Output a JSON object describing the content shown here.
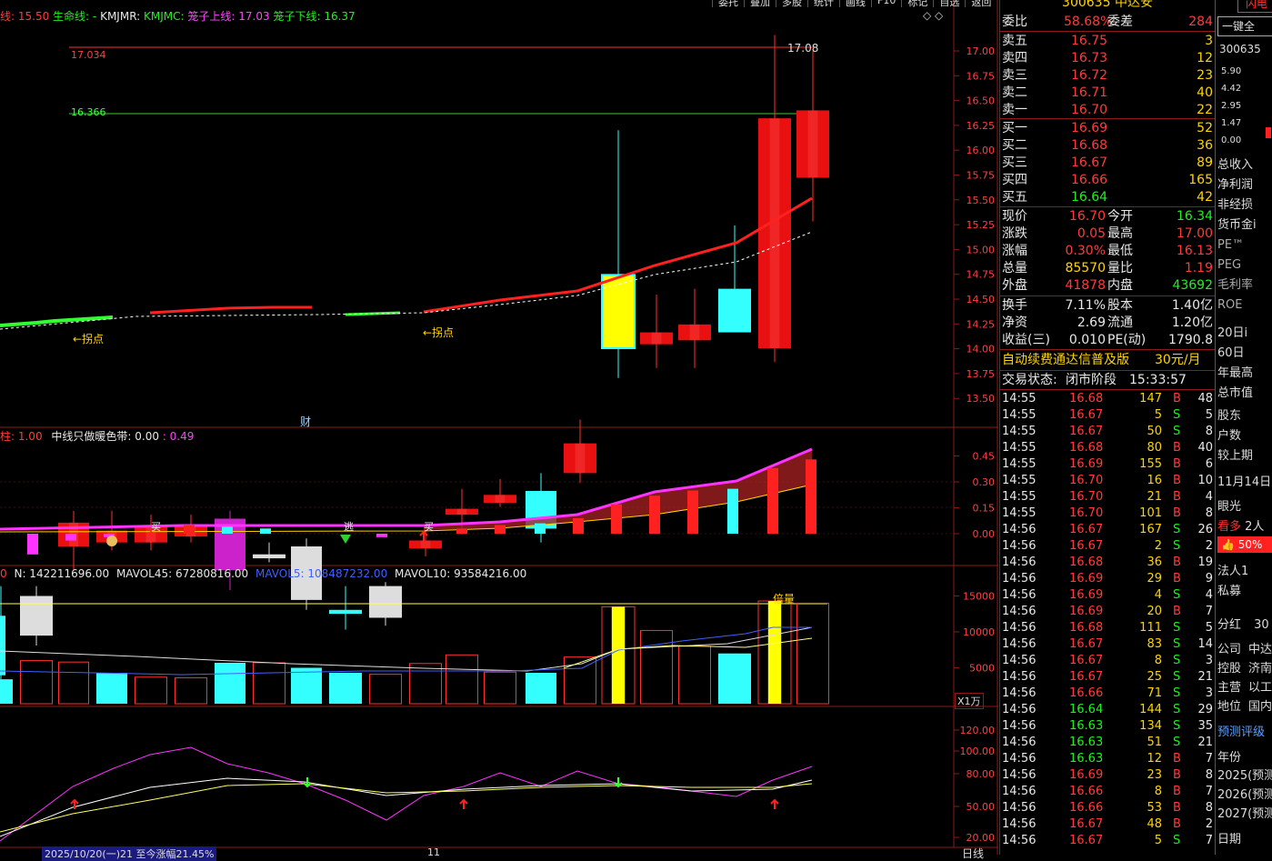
{
  "top_line": {
    "prefix": "线: 15.50",
    "shengming": "生命线: -",
    "kmjmr": "KMJMR:",
    "kmjmc": "KMJMC:",
    "up_label": "笼子上线: 17.03",
    "down_label": "笼子下线: 16.37"
  },
  "menu": [
    "委托",
    "叠加",
    "多股",
    "统计",
    "画线",
    "F10",
    "标记",
    "自选",
    "返回"
  ],
  "price_axis": [
    "17.00",
    "16.75",
    "16.50",
    "16.25",
    "16.00",
    "15.75",
    "15.50",
    "15.25",
    "15.00",
    "14.75",
    "14.50",
    "14.25",
    "14.00",
    "13.75",
    "13.50"
  ],
  "main_annotations": {
    "high_mark": "17.08",
    "upper_line": "17.034",
    "lower_line": "16.366",
    "guaidian_1": "←拐点",
    "guaidian_2": "←拐点",
    "cai": "财"
  },
  "ind1": {
    "title_a": "柱: 1.00",
    "title_b": "中线只做暖色带: 0.00",
    "title_c": ": 0.49",
    "axis": [
      "0.45",
      "0.30",
      "0.15",
      "0.00"
    ],
    "mark_buy1": "买",
    "mark_escape": "逃",
    "mark_buy2": "买"
  },
  "vol": {
    "t1": "0",
    "t2": "N: 142211696.00",
    "t3": "MAVOL45: 67280816.00",
    "t4": "MAVOL5: 108487232.00",
    "t5": "MAVOL10: 93584216.00",
    "axis": [
      "15000",
      "10000",
      "5000"
    ],
    "unit": "X1万",
    "beiliang": "倍量"
  },
  "ind3": {
    "axis": [
      "120.00",
      "100.00",
      "80.00",
      "50.00",
      "20.00"
    ]
  },
  "bottom": {
    "status": "2025/10/20(一)21 至今涨幅21.45%",
    "month": "11",
    "period": "日线"
  },
  "quote": {
    "code": "300635",
    "name": "中达安",
    "weibi_label": "委比",
    "weibi_val": "58.68%",
    "weicha_label": "委差",
    "weicha_val": "284",
    "sells": [
      {
        "label": "卖五",
        "price": "16.75",
        "vol": "3"
      },
      {
        "label": "卖四",
        "price": "16.73",
        "vol": "12"
      },
      {
        "label": "卖三",
        "price": "16.72",
        "vol": "23"
      },
      {
        "label": "卖二",
        "price": "16.71",
        "vol": "40"
      },
      {
        "label": "卖一",
        "price": "16.70",
        "vol": "22"
      }
    ],
    "buys": [
      {
        "label": "买一",
        "price": "16.69",
        "vol": "52"
      },
      {
        "label": "买二",
        "price": "16.68",
        "vol": "36"
      },
      {
        "label": "买三",
        "price": "16.67",
        "vol": "89"
      },
      {
        "label": "买四",
        "price": "16.66",
        "vol": "165"
      },
      {
        "label": "买五",
        "price": "16.64",
        "vol": "42"
      }
    ],
    "stats": [
      {
        "l1": "现价",
        "v1": "16.70",
        "l2": "今开",
        "v2": "16.34"
      },
      {
        "l1": "涨跌",
        "v1": "0.05",
        "l2": "最高",
        "v2": "17.00"
      },
      {
        "l1": "涨幅",
        "v1": "0.30%",
        "l2": "最低",
        "v2": "16.13"
      },
      {
        "l1": "总量",
        "v1": "85570",
        "l2": "量比",
        "v2": "1.19"
      },
      {
        "l1": "外盘",
        "v1": "41878",
        "l2": "内盘",
        "v2": "43692"
      }
    ],
    "stats2": [
      {
        "l1": "换手",
        "v1": "7.11%",
        "l2": "股本",
        "v2": "1.40亿"
      },
      {
        "l1": "净资",
        "v1": "2.69",
        "l2": "流通",
        "v2": "1.20亿"
      },
      {
        "l1": "收益(三)",
        "v1": "0.010",
        "l2": "PE(动)",
        "v2": "1790.8"
      }
    ],
    "promo": "自动续费通达信普及版",
    "promo_price": "30元/月",
    "trade_status_label": "交易状态:",
    "trade_status": "闭市阶段",
    "trade_time": "15:33:57"
  },
  "ticks": [
    {
      "t": "14:55",
      "p": "16.68",
      "v": "147",
      "d": "B",
      "n": "48"
    },
    {
      "t": "14:55",
      "p": "16.67",
      "v": "5",
      "d": "S",
      "n": "5"
    },
    {
      "t": "14:55",
      "p": "16.67",
      "v": "50",
      "d": "S",
      "n": "8"
    },
    {
      "t": "14:55",
      "p": "16.68",
      "v": "80",
      "d": "B",
      "n": "40"
    },
    {
      "t": "14:55",
      "p": "16.69",
      "v": "155",
      "d": "B",
      "n": "6"
    },
    {
      "t": "14:55",
      "p": "16.70",
      "v": "16",
      "d": "B",
      "n": "10"
    },
    {
      "t": "14:55",
      "p": "16.70",
      "v": "21",
      "d": "B",
      "n": "4"
    },
    {
      "t": "14:55",
      "p": "16.70",
      "v": "101",
      "d": "B",
      "n": "8"
    },
    {
      "t": "14:56",
      "p": "16.67",
      "v": "167",
      "d": "S",
      "n": "26"
    },
    {
      "t": "14:56",
      "p": "16.67",
      "v": "2",
      "d": "S",
      "n": "2"
    },
    {
      "t": "14:56",
      "p": "16.68",
      "v": "36",
      "d": "B",
      "n": "19"
    },
    {
      "t": "14:56",
      "p": "16.69",
      "v": "29",
      "d": "B",
      "n": "9"
    },
    {
      "t": "14:56",
      "p": "16.69",
      "v": "4",
      "d": "S",
      "n": "4"
    },
    {
      "t": "14:56",
      "p": "16.69",
      "v": "20",
      "d": "B",
      "n": "7"
    },
    {
      "t": "14:56",
      "p": "16.68",
      "v": "111",
      "d": "S",
      "n": "5"
    },
    {
      "t": "14:56",
      "p": "16.67",
      "v": "83",
      "d": "S",
      "n": "14"
    },
    {
      "t": "14:56",
      "p": "16.67",
      "v": "8",
      "d": "S",
      "n": "3"
    },
    {
      "t": "14:56",
      "p": "16.67",
      "v": "25",
      "d": "S",
      "n": "21"
    },
    {
      "t": "14:56",
      "p": "16.66",
      "v": "71",
      "d": "S",
      "n": "3"
    },
    {
      "t": "14:56",
      "p": "16.64",
      "v": "144",
      "d": "S",
      "n": "29"
    },
    {
      "t": "14:56",
      "p": "16.63",
      "v": "134",
      "d": "S",
      "n": "35"
    },
    {
      "t": "14:56",
      "p": "16.63",
      "v": "51",
      "d": "S",
      "n": "21"
    },
    {
      "t": "14:56",
      "p": "16.63",
      "v": "12",
      "d": "B",
      "n": "7"
    },
    {
      "t": "14:56",
      "p": "16.69",
      "v": "23",
      "d": "B",
      "n": "8"
    },
    {
      "t": "14:56",
      "p": "16.66",
      "v": "8",
      "d": "B",
      "n": "7"
    },
    {
      "t": "14:56",
      "p": "16.66",
      "v": "53",
      "d": "B",
      "n": "8"
    },
    {
      "t": "14:56",
      "p": "16.67",
      "v": "48",
      "d": "B",
      "n": "2"
    },
    {
      "t": "14:56",
      "p": "16.67",
      "v": "5",
      "d": "S",
      "n": "7"
    }
  ],
  "side": {
    "tab": "闪电",
    "btn": "一键全",
    "code": "300635",
    "axis": [
      "5.90",
      "4.42",
      "2.95",
      "1.47",
      "0.00"
    ],
    "items": [
      "总收入",
      "净利润",
      "非经损",
      "货币金i",
      "PE™",
      "PEG",
      "毛利率",
      "ROE"
    ],
    "items2": [
      "20日i",
      "60日",
      "年最高",
      "总市值"
    ],
    "items3": [
      "股东",
      "户数",
      "较上期"
    ],
    "date": "11月14日",
    "eye": "眼光",
    "kanduo": "看多",
    "kanduo_n": "2人",
    "pct": "50%",
    "items4": [
      "法人1",
      "私募"
    ],
    "fenhong": "分红",
    "fenhong_v": "30",
    "company": [
      {
        "k": "公司",
        "v": "中达"
      },
      {
        "k": "控股",
        "v": "济南"
      },
      {
        "k": "主营",
        "v": "以工"
      },
      {
        "k": "地位",
        "v": "国内"
      }
    ],
    "rating": "预测评级",
    "years_label": "年份",
    "years": [
      "2025(预测)",
      "2026(预测)",
      "2027(预测)"
    ],
    "date_label": "日期"
  },
  "colors": {
    "up": "#ff2020",
    "down": "#33ffff",
    "grid": "#8b1a1a",
    "accent": "#ffd400"
  }
}
